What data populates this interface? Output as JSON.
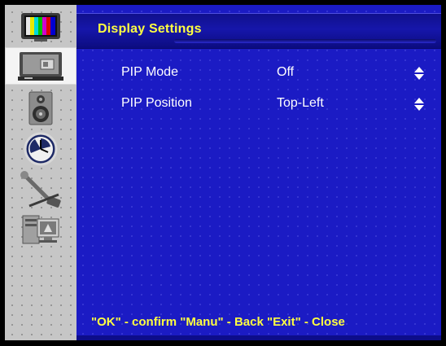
{
  "menu": {
    "title": "Display Settings",
    "sidebar": {
      "selected": "display",
      "items": [
        {
          "name": "picture",
          "icon": "tv-color-bars-icon"
        },
        {
          "name": "display",
          "icon": "monitor-icon"
        },
        {
          "name": "audio",
          "icon": "speaker-icon"
        },
        {
          "name": "time",
          "icon": "clock-icon"
        },
        {
          "name": "tools",
          "icon": "wrench-icon"
        },
        {
          "name": "system",
          "icon": "computer-icon"
        }
      ]
    },
    "settings": [
      {
        "label": "PIP Mode",
        "value": "Off"
      },
      {
        "label": "PIP Position",
        "value": "Top-Left"
      }
    ],
    "footer_hint": "\"OK\" - confirm \"Manu\" - Back \"Exit\" - Close"
  },
  "colors": {
    "panel_blue": "#1b1bc4",
    "title_yellow": "#ffff40",
    "sidebar_grey": "#c6c6c6",
    "text_white": "#ffffff"
  }
}
